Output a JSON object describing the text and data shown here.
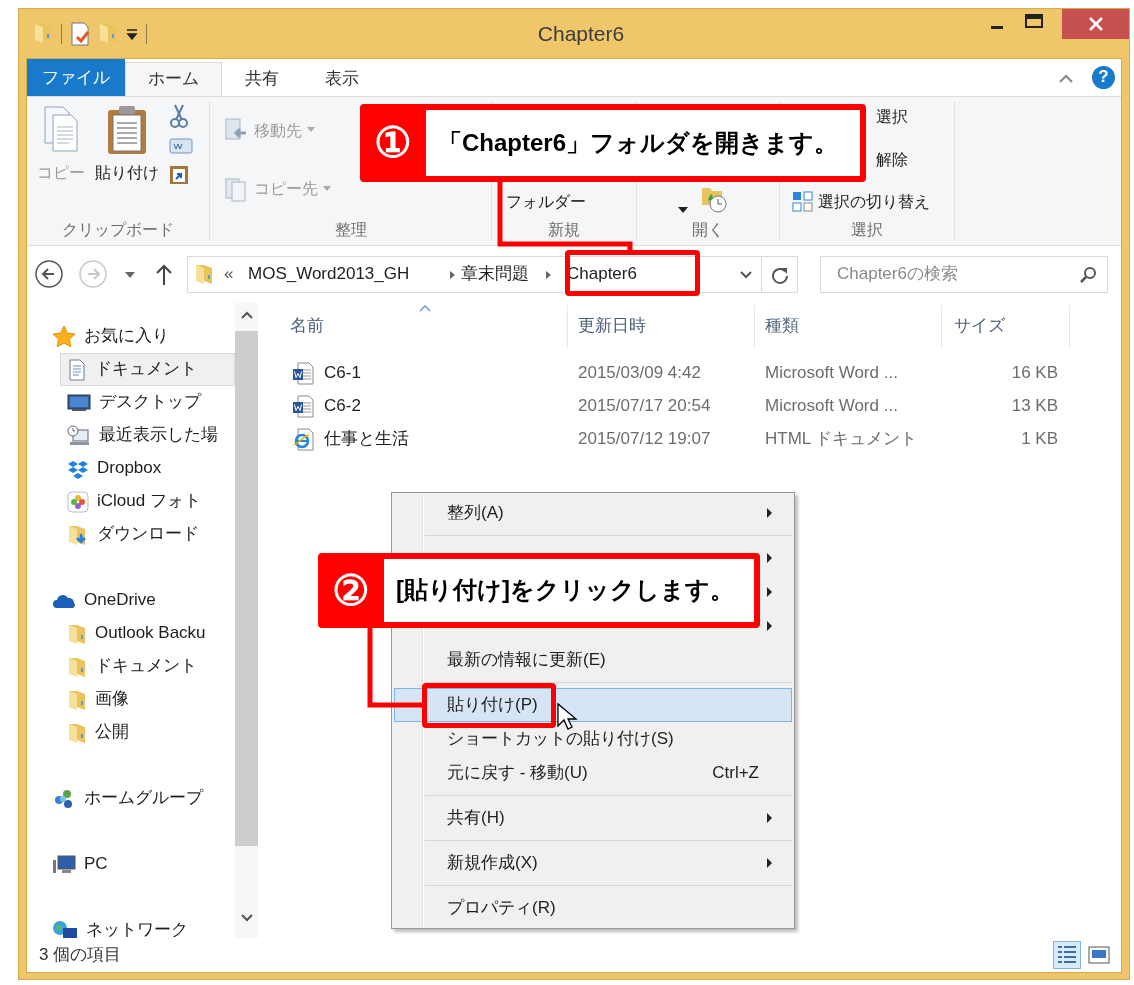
{
  "window": {
    "title": "Chapter6"
  },
  "ribbon": {
    "help_label": "?",
    "tabs": [
      {
        "label": "ファイル",
        "kind": "file",
        "selected": false
      },
      {
        "label": "ホーム",
        "kind": "tab",
        "selected": true
      },
      {
        "label": "共有",
        "kind": "tab",
        "selected": false
      },
      {
        "label": "表示",
        "kind": "tab",
        "selected": false
      }
    ],
    "groups": [
      {
        "label": "クリップボード",
        "columns": [
          [
            {
              "kind": "large",
              "label": "コピー",
              "disabled": true
            }
          ],
          [
            {
              "kind": "large",
              "label": "貼り付け",
              "disabled": false
            }
          ],
          [
            {
              "kind": "icon"
            },
            {
              "kind": "icon"
            },
            {
              "kind": "icon"
            }
          ]
        ]
      },
      {
        "label": "整理",
        "columns": [
          [
            {
              "kind": "small",
              "label": "移動先",
              "disabled": true,
              "dropdown": true
            },
            {
              "kind": "small",
              "label": "コピー先",
              "disabled": true,
              "dropdown": true
            }
          ]
        ]
      },
      {
        "label": "新規",
        "columns": [
          [
            {
              "kind": "tail",
              "label": "フォルダー",
              "disabled": false
            }
          ]
        ]
      },
      {
        "label": "開く",
        "columns": [
          [
            {
              "kind": "arrow"
            }
          ],
          [
            {
              "kind": "icon"
            }
          ]
        ]
      },
      {
        "label": "選択",
        "columns": [
          [
            {
              "kind": "tail",
              "label": "選択",
              "disabled": false
            },
            {
              "kind": "tail",
              "label": "解除",
              "disabled": false
            },
            {
              "kind": "small",
              "label": "選択の切り替え",
              "disabled": false
            }
          ]
        ]
      }
    ]
  },
  "address_bar": {
    "nav": [
      {
        "kind": "back",
        "disabled": false
      },
      {
        "kind": "forward",
        "disabled": true
      }
    ],
    "overflow": "«",
    "path": [
      "MOS_Word2013_GH",
      "章末問題",
      "Chapter6"
    ]
  },
  "search": {
    "placeholder": "Chapter6の検索"
  },
  "navigation": [
    {
      "label": "お気に入り",
      "kind": "star",
      "selected": false,
      "children": [
        {
          "label": "ドキュメント",
          "kind": "doc",
          "selected": true
        },
        {
          "label": "デスクトップ",
          "kind": "desktop",
          "selected": false
        },
        {
          "label": "最近表示した場",
          "kind": "recent",
          "selected": false
        },
        {
          "label": "Dropbox",
          "kind": "dropbox",
          "selected": false
        },
        {
          "label": "iCloud フォト",
          "kind": "photos",
          "selected": false
        },
        {
          "label": "ダウンロード",
          "kind": "download",
          "selected": false
        }
      ]
    },
    {
      "label": "OneDrive",
      "kind": "cloud",
      "selected": false,
      "children": [
        {
          "label": "Outlook Backu",
          "kind": "folder",
          "selected": false
        },
        {
          "label": "ドキュメント",
          "kind": "folder",
          "selected": false
        },
        {
          "label": "画像",
          "kind": "folder",
          "selected": false
        },
        {
          "label": "公開",
          "kind": "folder",
          "selected": false
        }
      ]
    },
    {
      "label": "ホームグループ",
      "kind": "homegroup",
      "selected": false
    },
    {
      "label": "PC",
      "kind": "pc",
      "selected": false
    },
    {
      "label": "ネットワーク",
      "kind": "network",
      "selected": false
    }
  ],
  "file_list": {
    "columns": [
      {
        "label": "名前",
        "sorted": true
      },
      {
        "label": "更新日時",
        "sorted": false
      },
      {
        "label": "種類",
        "sorted": false
      },
      {
        "label": "サイズ",
        "sorted": false
      }
    ],
    "rows": [
      {
        "name": "C6-1",
        "kind": "word",
        "modified": "2015/03/09 4:42",
        "type": "Microsoft Word ...",
        "size": "16 KB"
      },
      {
        "name": "C6-2",
        "kind": "word",
        "modified": "2015/07/17 20:54",
        "type": "Microsoft Word ...",
        "size": "13 KB"
      },
      {
        "name": "仕事と生活",
        "kind": "html",
        "modified": "2015/07/12 19:07",
        "type": "HTML ドキュメント",
        "size": "1 KB"
      }
    ]
  },
  "context_menu": {
    "items": [
      {
        "kind": "item",
        "label": "整列(A)",
        "submenu": true,
        "selected": false
      },
      {
        "kind": "separator"
      },
      {
        "kind": "covered",
        "submenu": true
      },
      {
        "kind": "covered",
        "submenu": true
      },
      {
        "kind": "covered",
        "submenu": true
      },
      {
        "kind": "item",
        "label": "最新の情報に更新(E)",
        "submenu": false,
        "selected": false
      },
      {
        "kind": "separator"
      },
      {
        "kind": "item",
        "label": "貼り付け(P)",
        "submenu": false,
        "selected": true
      },
      {
        "kind": "item",
        "label": "ショートカットの貼り付け(S)",
        "submenu": false,
        "selected": false
      },
      {
        "kind": "item",
        "label": "元に戻す - 移動(U)",
        "shortcut": "Ctrl+Z",
        "submenu": false,
        "selected": false
      },
      {
        "kind": "separator"
      },
      {
        "kind": "item",
        "label": "共有(H)",
        "submenu": true,
        "selected": false
      },
      {
        "kind": "separator"
      },
      {
        "kind": "item",
        "label": "新規作成(X)",
        "submenu": true,
        "selected": false
      },
      {
        "kind": "separator"
      },
      {
        "kind": "item",
        "label": "プロパティ(R)",
        "submenu": false,
        "selected": false
      }
    ]
  },
  "callouts": [
    {
      "number": "①",
      "text": "「Chapter6」フォルダを開きます。"
    },
    {
      "number": "②",
      "text": "[貼り付け]をクリックします。"
    }
  ],
  "status_bar": {
    "text": "3 個の項目",
    "views": [
      {
        "kind": "details",
        "selected": true
      },
      {
        "kind": "large-icons",
        "selected": false
      }
    ]
  }
}
